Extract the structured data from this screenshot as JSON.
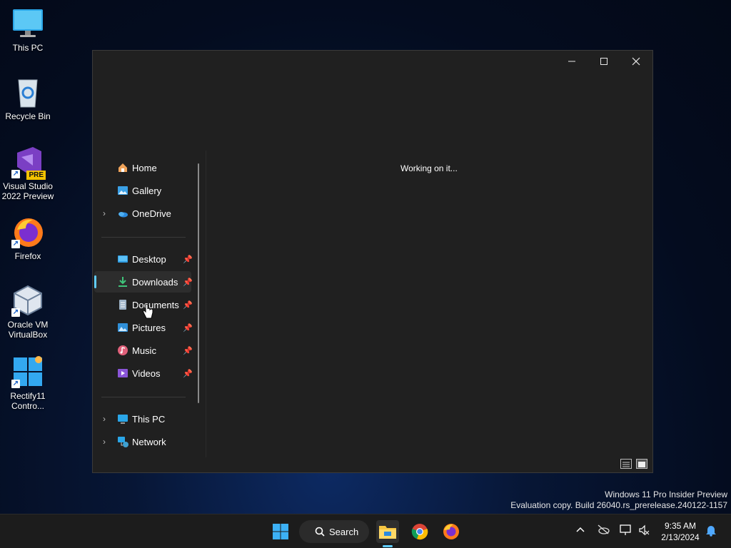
{
  "desktop": {
    "icons": [
      {
        "label": "This PC"
      },
      {
        "label": "Recycle Bin"
      },
      {
        "label": "Visual Studio 2022 Preview",
        "badge": "PRE"
      },
      {
        "label": "Firefox"
      },
      {
        "label": "Oracle VM VirtualBox"
      },
      {
        "label": "Rectify11 Contro..."
      }
    ]
  },
  "window": {
    "caption": {
      "minimize": "—",
      "maximize": "☐",
      "close": "✕"
    },
    "nav": {
      "top": [
        {
          "label": "Home",
          "icon": "home-icon"
        },
        {
          "label": "Gallery",
          "icon": "gallery-icon"
        },
        {
          "label": "OneDrive",
          "icon": "onedrive-icon"
        }
      ],
      "quick_access": [
        {
          "label": "Desktop",
          "icon": "desktop-folder-icon"
        },
        {
          "label": "Downloads",
          "icon": "downloads-icon",
          "selected": true
        },
        {
          "label": "Documents",
          "icon": "documents-icon"
        },
        {
          "label": "Pictures",
          "icon": "pictures-icon"
        },
        {
          "label": "Music",
          "icon": "music-icon"
        },
        {
          "label": "Videos",
          "icon": "videos-icon"
        }
      ],
      "bottom": [
        {
          "label": "This PC",
          "icon": "this-pc-icon"
        },
        {
          "label": "Network",
          "icon": "network-icon"
        }
      ]
    },
    "status_text": "Working on it..."
  },
  "watermark": {
    "line1": "Windows 11 Pro Insider Preview",
    "line2": "Evaluation copy. Build 26040.rs_prerelease.240122-1157"
  },
  "taskbar": {
    "search_label": "Search",
    "clock": {
      "time": "9:35 AM",
      "date": "2/13/2024"
    }
  },
  "colors": {
    "accent": "#60cdff",
    "window_bg": "#202020",
    "taskbar_bg": "#1c1c1c"
  }
}
